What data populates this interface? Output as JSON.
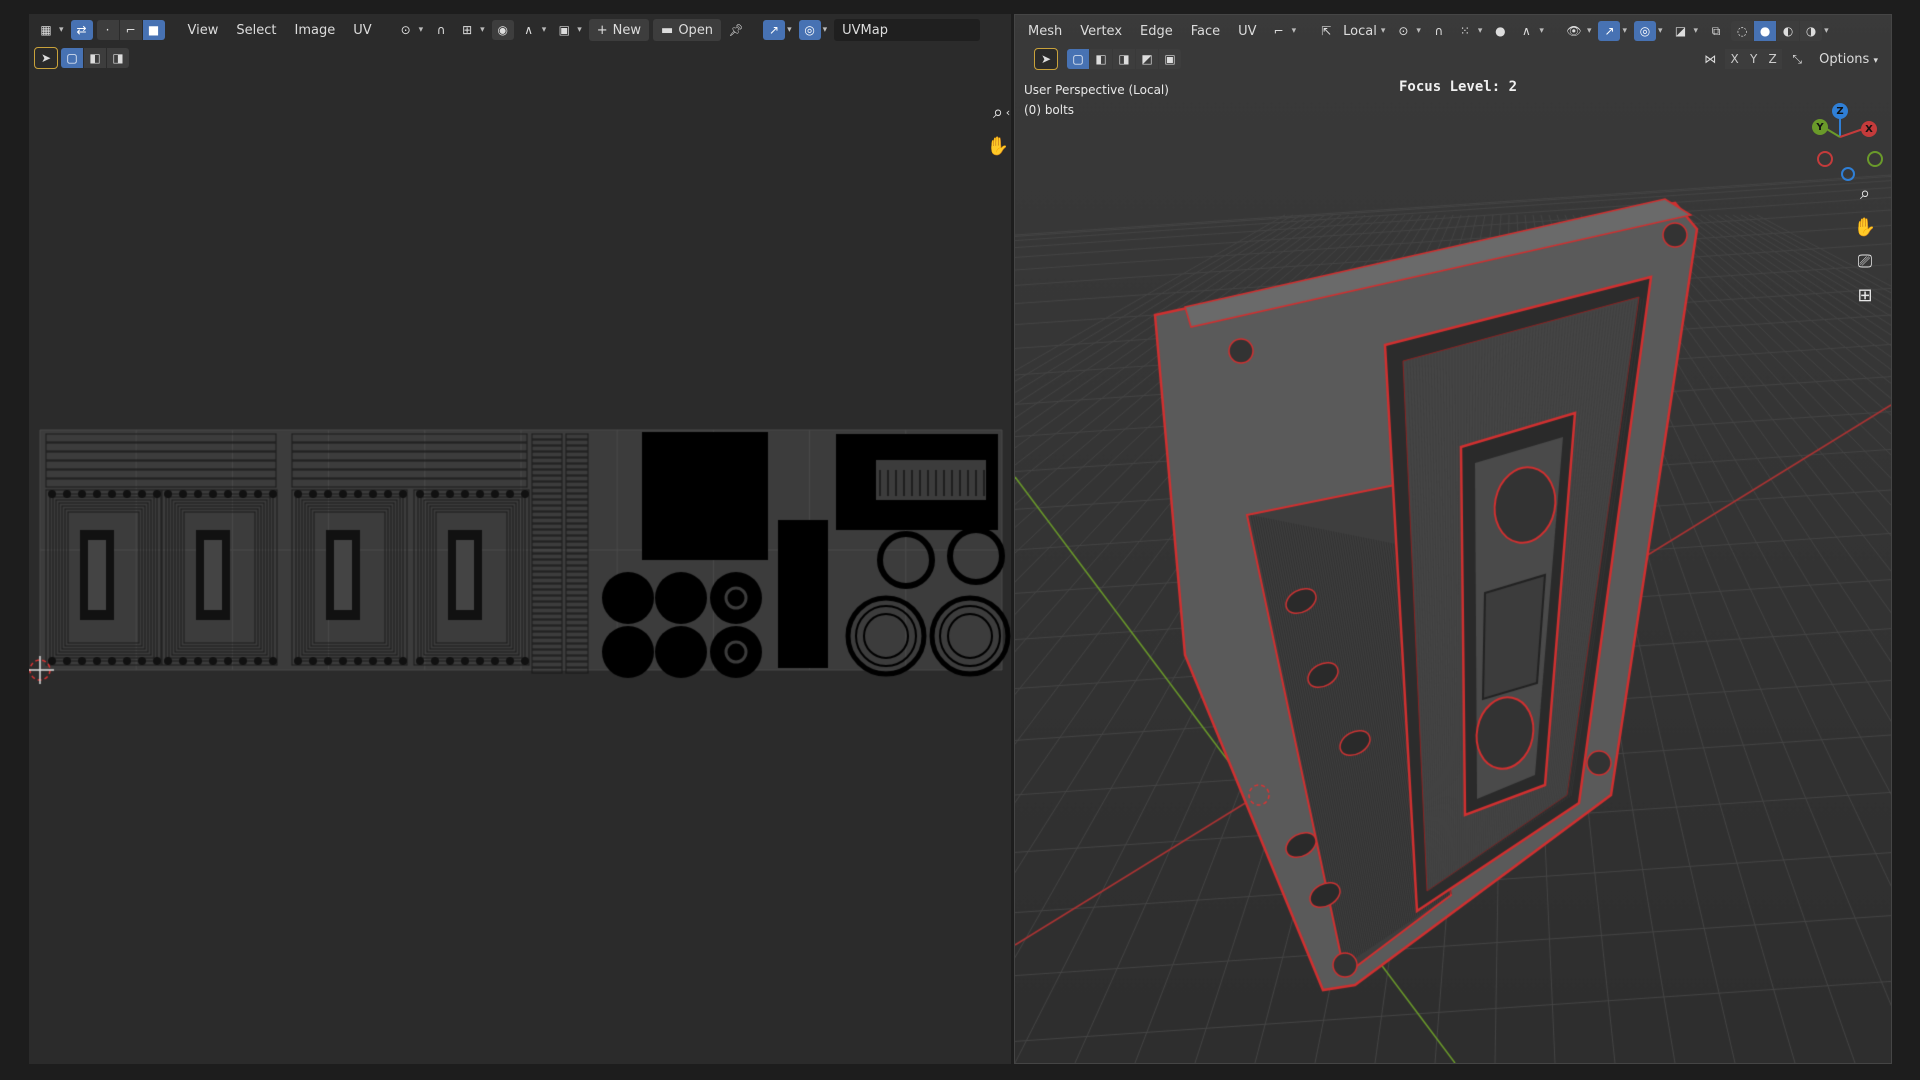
{
  "uv_editor": {
    "menus": [
      "View",
      "Select",
      "Image",
      "UV"
    ],
    "new_label": "New",
    "open_label": "Open",
    "uvmap_name": "UVMap"
  },
  "viewport": {
    "menus": [
      "Mesh",
      "Vertex",
      "Edge",
      "Face",
      "UV"
    ],
    "orientation": "Local",
    "axis_x": "X",
    "axis_y": "Y",
    "axis_z": "Z",
    "options_label": "Options",
    "perspective_label": "User Perspective (Local)",
    "object_label": "(0) bolts",
    "focus_level": "Focus Level: 2",
    "gizmo": {
      "z": "Z",
      "y": "Y",
      "x": "X"
    }
  },
  "colors": {
    "accent": "#4772b3",
    "wire": "#e03030",
    "x_axis": "#c43b3b",
    "y_axis": "#6a9a2a",
    "z_axis": "#2f7fd6"
  }
}
